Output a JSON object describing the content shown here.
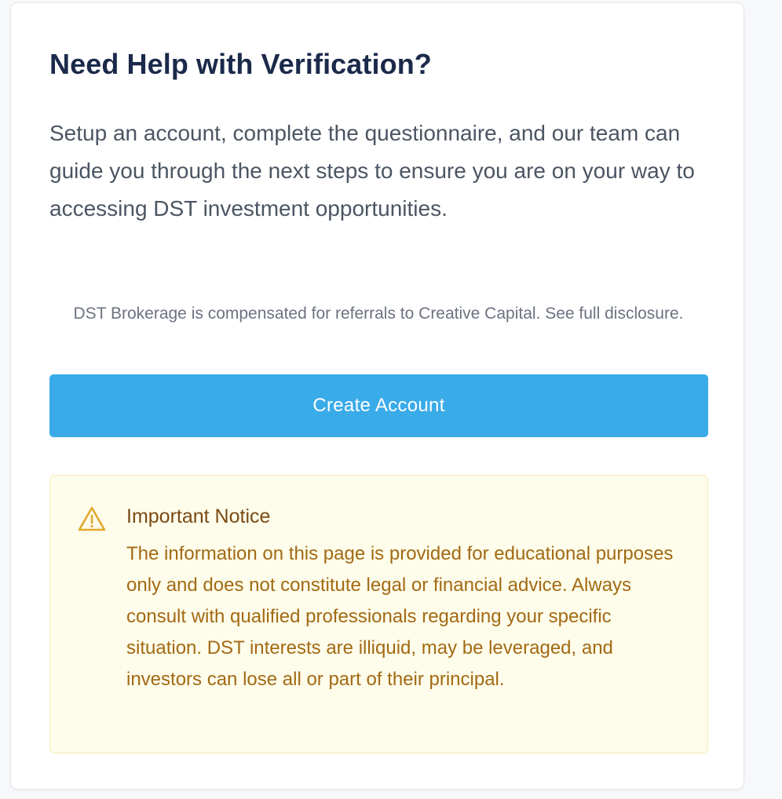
{
  "card": {
    "title": "Need Help with Verification?",
    "description": "Setup an account, complete the questionnaire, and our team can guide you through the next steps to ensure you are on your way to accessing DST investment opportunities.",
    "disclosure": "DST Brokerage is compensated for referrals to Creative Capital. See full disclosure.",
    "create_account_label": "Create Account"
  },
  "notice": {
    "icon": "warning-triangle-icon",
    "title": "Important Notice",
    "body": "The information on this page is provided for educational purposes only and does not constitute legal or financial advice. Always consult with qualified professionals regarding your specific situation. DST interests are illiquid, may be leveraged, and investors can lose all or part of their principal."
  },
  "colors": {
    "title": "#1b2a4a",
    "text": "#4b5563",
    "muted": "#6b7280",
    "button_bg": "#3aabe9",
    "notice_bg": "#fefcea",
    "notice_border": "#f8ecb4",
    "notice_title": "#7a4a14",
    "notice_text": "#a26a14",
    "warning_icon": "#e0a82e"
  }
}
